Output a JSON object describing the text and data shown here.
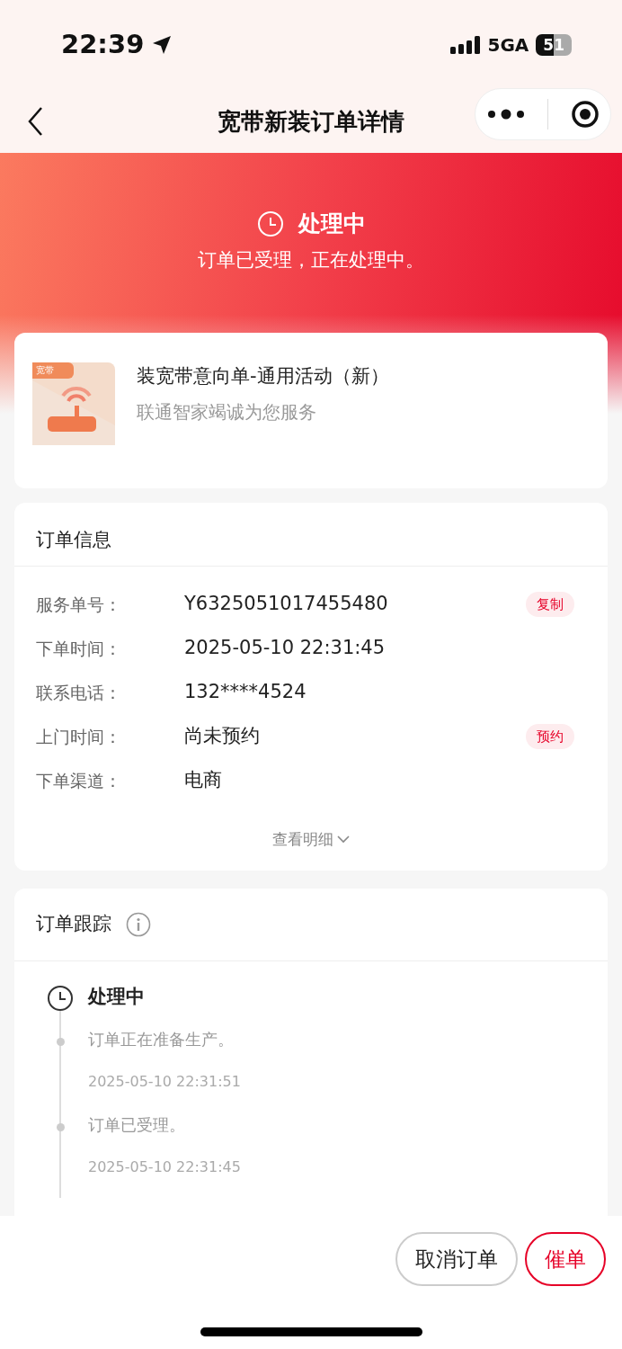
{
  "status_bar": {
    "time": "22:39",
    "network": "5GA",
    "battery": "51"
  },
  "nav": {
    "title": "宽带新装订单详情"
  },
  "status_banner": {
    "title": "处理中",
    "message": "订单已受理，正在处理中。"
  },
  "product": {
    "tag": "宽带",
    "name": "装宽带意向单-通用活动（新）",
    "subtitle": "联通智家竭诚为您服务"
  },
  "order_info": {
    "title": "订单信息",
    "rows": [
      {
        "label": "服务单号：",
        "value": "Y6325051017455480",
        "action": "复制"
      },
      {
        "label": "下单时间：",
        "value": "2025-05-10 22:31:45"
      },
      {
        "label": "联系电话：",
        "value": "132****4524"
      },
      {
        "label": "上门时间：",
        "value": "尚未预约",
        "action": "预约"
      },
      {
        "label": "下单渠道：",
        "value": "电商"
      }
    ],
    "more": "查看明细"
  },
  "tracking": {
    "title": "订单跟踪",
    "events": [
      {
        "kind": "stage",
        "title": "处理中"
      },
      {
        "kind": "step",
        "text": "订单正在准备生产。",
        "time": "2025-05-10 22:31:51"
      },
      {
        "kind": "step",
        "text": "订单已受理。",
        "time": "2025-05-10 22:31:45"
      }
    ]
  },
  "actions": [
    {
      "label": "取消订单",
      "kind": "secondary"
    },
    {
      "label": "催单",
      "kind": "primary"
    }
  ]
}
